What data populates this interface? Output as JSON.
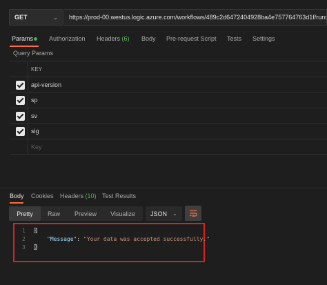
{
  "request": {
    "method": "GET",
    "url": "https://prod-00.westus.logic.azure.com/workflows/489c2d6472404928ba4e757764763d1f/runs"
  },
  "request_tabs": {
    "params": "Params",
    "authorization": "Authorization",
    "headers": "Headers",
    "headers_count": "(6)",
    "body": "Body",
    "pre_request_script": "Pre-request Script",
    "tests": "Tests",
    "settings": "Settings"
  },
  "query_params": {
    "title": "Query Params",
    "key_header": "KEY",
    "rows": [
      {
        "key": "api-version",
        "checked": true
      },
      {
        "key": "sp",
        "checked": true
      },
      {
        "key": "sv",
        "checked": true
      },
      {
        "key": "sig",
        "checked": true
      }
    ],
    "key_placeholder": "Key"
  },
  "response_tabs": {
    "body": "Body",
    "cookies": "Cookies",
    "headers": "Headers",
    "headers_count": "(10)",
    "test_results": "Test Results"
  },
  "view_modes": {
    "pretty": "Pretty",
    "raw": "Raw",
    "preview": "Preview",
    "visualize": "Visualize"
  },
  "format": {
    "selected": "JSON"
  },
  "response_body": {
    "line_numbers": [
      "1",
      "2",
      "3"
    ],
    "open_brace": "{",
    "close_brace": "}",
    "key": "\"Message\"",
    "colon": ": ",
    "value": "\"Your data was accepted successfully.\""
  },
  "colors": {
    "accent": "#ff6c37",
    "highlight_border": "#e0201f",
    "success": "#57b657"
  }
}
